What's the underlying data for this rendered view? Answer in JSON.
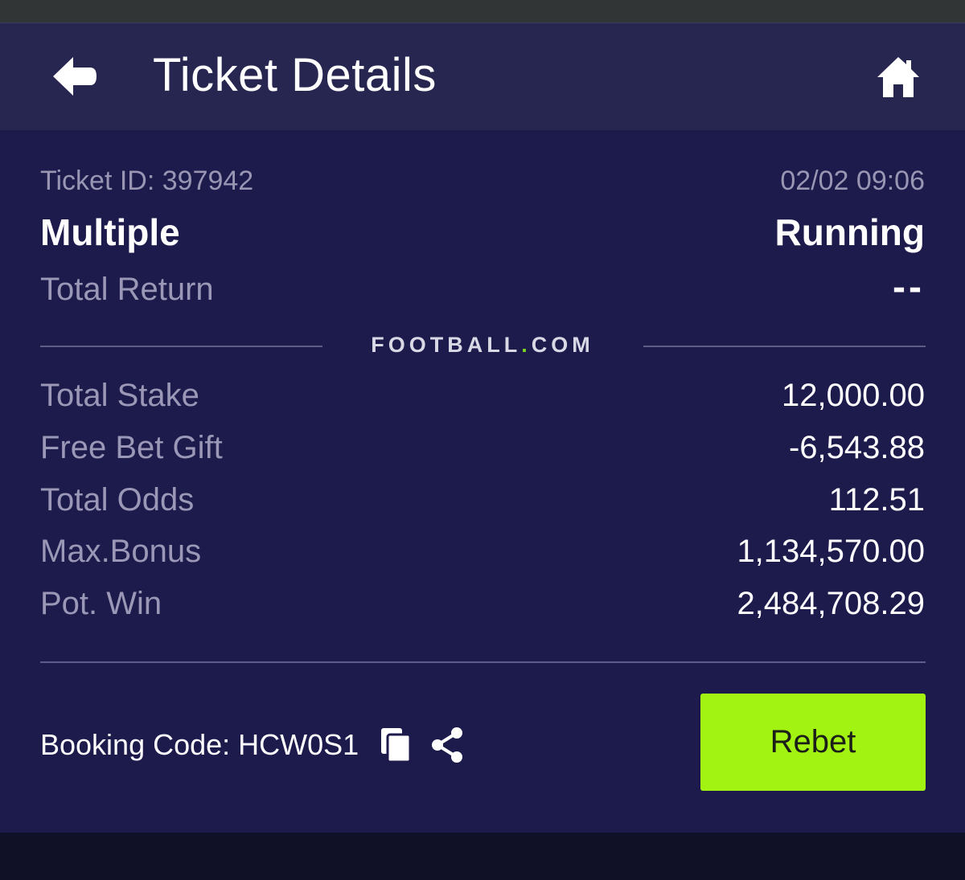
{
  "header": {
    "title": "Ticket Details",
    "back_icon": "arrow-left-icon",
    "home_icon": "home-icon"
  },
  "ticket": {
    "id_label": "Ticket ID: 397942",
    "datetime": "02/02 09:06",
    "type": "Multiple",
    "status": "Running",
    "total_return_label": "Total Return",
    "total_return_value": "--"
  },
  "brand": {
    "prefix": "FOOTBALL",
    "dot": ".",
    "suffix": "COM",
    "dot_color": "#7fd321"
  },
  "stats": [
    {
      "label": "Total Stake",
      "value": "12,000.00"
    },
    {
      "label": "Free Bet Gift",
      "value": "-6,543.88"
    },
    {
      "label": "Total Odds",
      "value": "112.51"
    },
    {
      "label": "Max.Bonus",
      "value": "1,134,570.00"
    },
    {
      "label": "Pot. Win",
      "value": "2,484,708.29"
    }
  ],
  "booking": {
    "text": "Booking Code: HCW0S1",
    "copy_icon": "copy-icon",
    "share_icon": "share-icon"
  },
  "actions": {
    "rebet_label": "Rebet",
    "rebet_color": "#a3f312"
  },
  "colors": {
    "background": "#1d1a4c",
    "header": "#272650",
    "muted_text": "#9a98b6"
  }
}
